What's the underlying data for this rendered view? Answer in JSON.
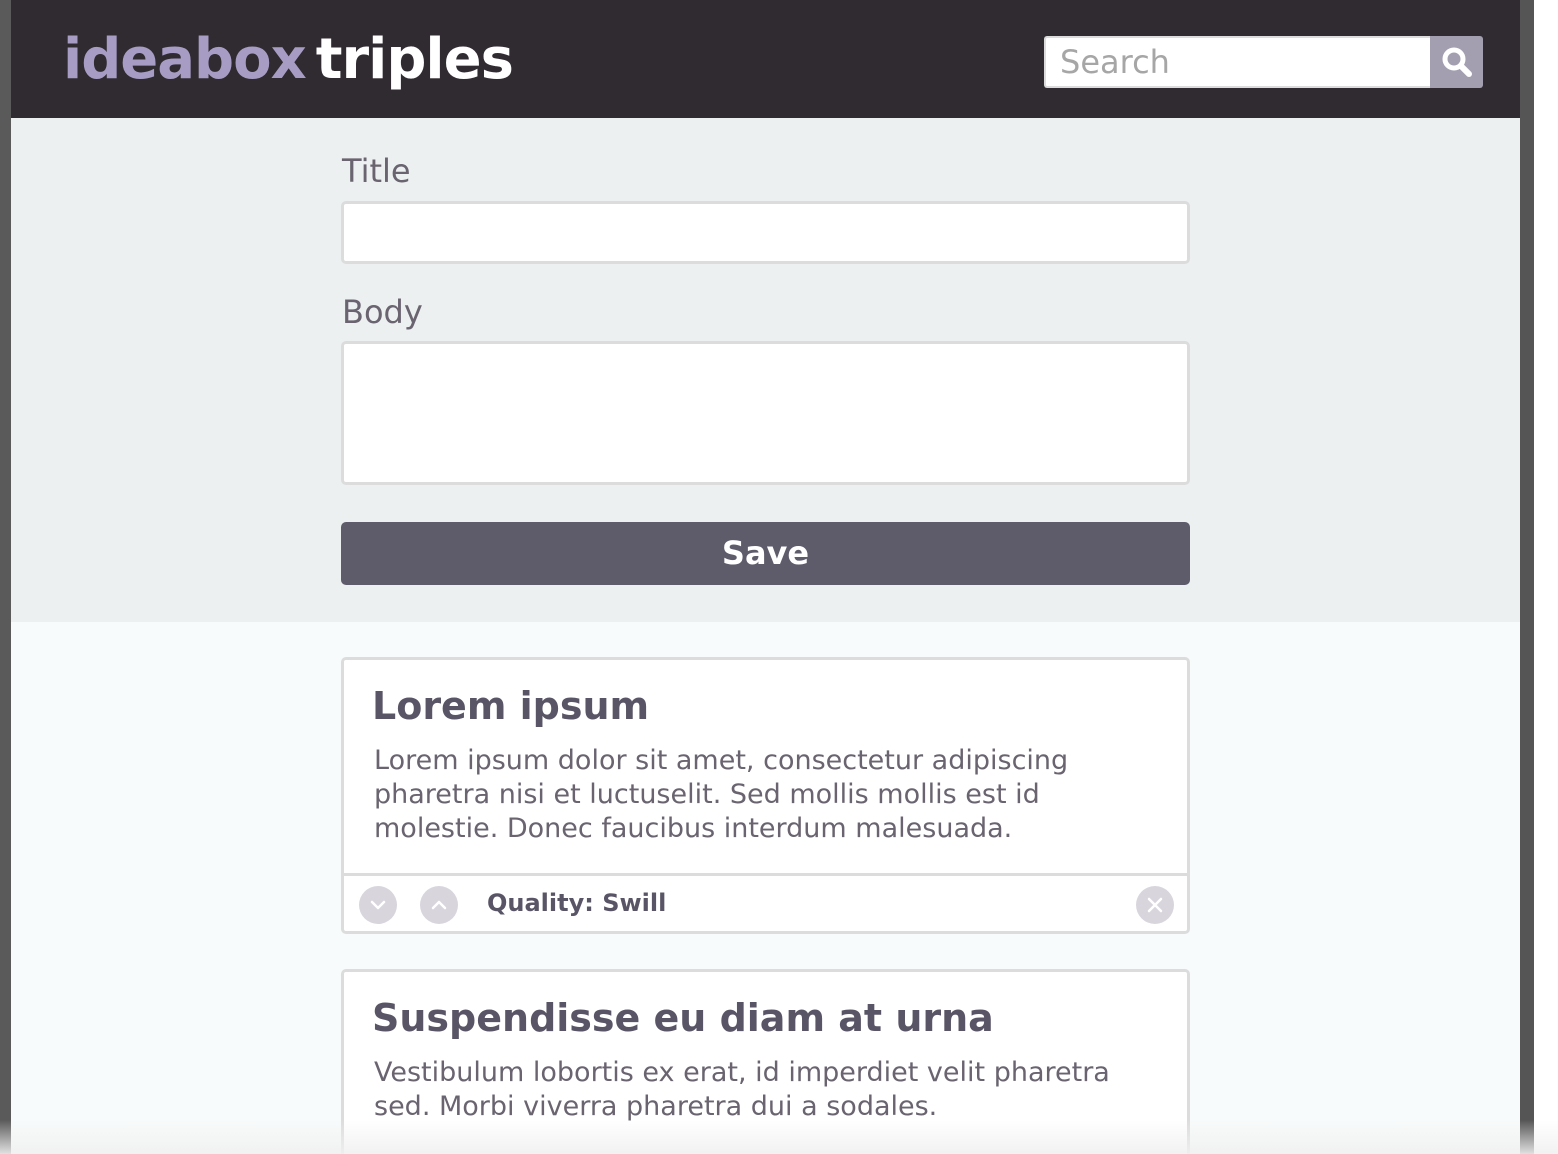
{
  "header": {
    "logo_primary": "ideabox",
    "logo_secondary": "triples",
    "search_placeholder": "Search",
    "search_icon": "magnifier-icon"
  },
  "form": {
    "title_label": "Title",
    "title_value": "",
    "body_label": "Body",
    "body_value": "",
    "save_label": "Save"
  },
  "ideas": [
    {
      "title": "Lorem ipsum",
      "body": "Lorem ipsum dolor sit amet, consectetur adipiscing pharetra nisi et luctuselit. Sed mollis mollis est id molestie. Donec faucibus interdum malesuada.",
      "quality": "Quality: Swill",
      "icons": {
        "downvote": "chevron-down-icon",
        "upvote": "chevron-up-icon",
        "delete": "close-icon"
      }
    },
    {
      "title": "Suspendisse eu diam at urna",
      "body": "Vestibulum lobortis ex erat, id imperdiet velit pharetra sed. Morbi viverra pharetra dui a sodales."
    }
  ],
  "colors": {
    "header_bg": "#302a31",
    "logo_accent": "#a79dc4",
    "form_bg": "#ecf0f1",
    "save_button": "#5e5b6b",
    "card_title": "#5a5566",
    "search_button": "#a39fb0"
  }
}
